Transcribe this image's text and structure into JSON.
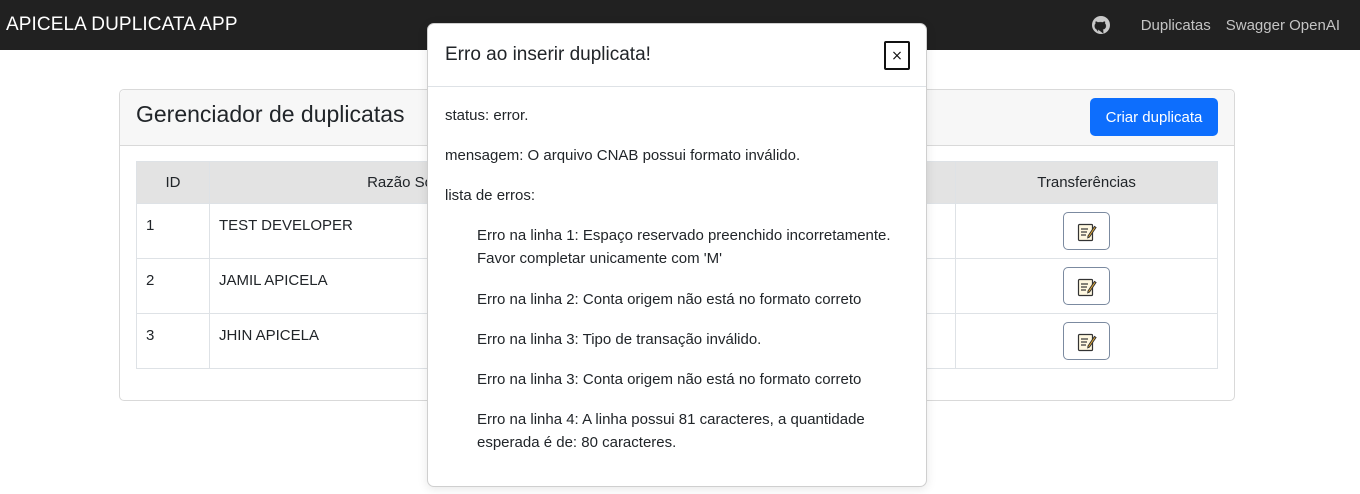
{
  "navbar": {
    "brand": "APICELA DUPLICATA APP",
    "icon": "github-icon",
    "links": [
      "Duplicatas",
      "Swagger OpenAI"
    ]
  },
  "card": {
    "title": "Gerenciador de duplicatas",
    "create_button": "Criar duplicata",
    "table": {
      "headers": [
        "ID",
        "Razão Social",
        "",
        "Transferências"
      ],
      "rows": [
        {
          "id": "1",
          "razao_social": "TEST DEVELOPER"
        },
        {
          "id": "2",
          "razao_social": "JAMIL APICELA"
        },
        {
          "id": "3",
          "razao_social": "JHIN APICELA"
        }
      ],
      "row_action_icon": "edit-note-icon"
    }
  },
  "modal": {
    "title": "Erro ao inserir duplicata!",
    "close_label": "×",
    "status": "status: error.",
    "message": "mensagem: O arquivo CNAB possui formato inválido.",
    "errors_label": "lista de erros:",
    "errors": [
      "Erro na linha 1: Espaço reservado preenchido incorretamente. Favor completar unicamente com 'M'",
      "Erro na linha 2: Conta origem não está no formato correto",
      "Erro na linha 3: Tipo de transação inválido.",
      "Erro na linha 3: Conta origem não está no formato correto",
      "Erro na linha 4: A linha possui 81 caracteres, a quantidade esperada é de: 80 caracteres."
    ]
  },
  "colors": {
    "navbar_bg": "#212121",
    "primary": "#0d6efd",
    "table_header_bg": "#e3e3e3"
  }
}
